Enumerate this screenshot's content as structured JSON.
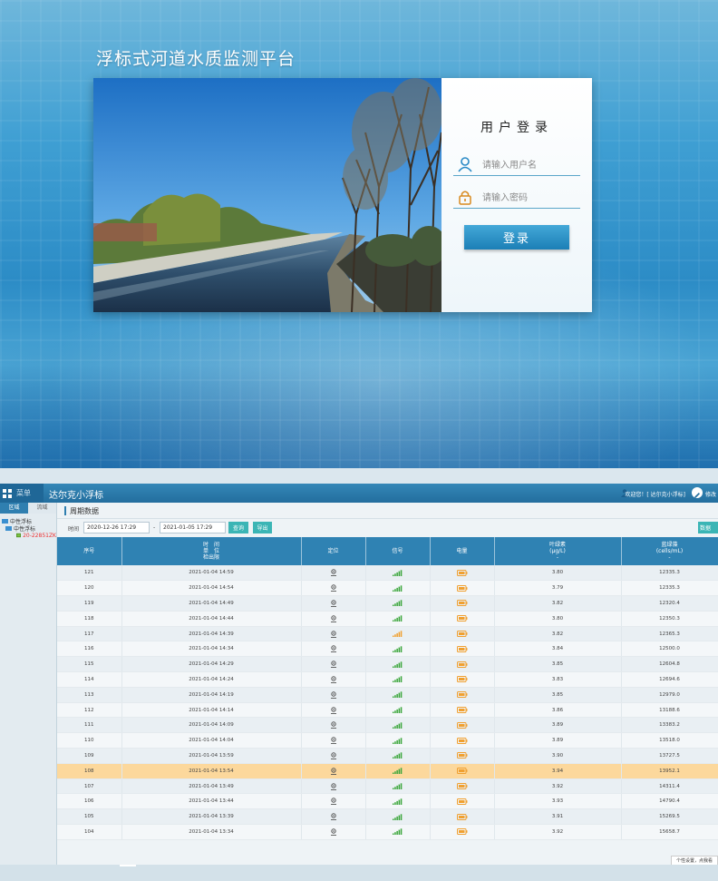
{
  "login": {
    "platform_title": "浮标式河道水质监测平台",
    "form_title": "用户登录",
    "username_placeholder": "请输入用户名",
    "password_placeholder": "请输入密码",
    "login_button": "登录"
  },
  "app": {
    "menu_label": "菜单",
    "title": "达尔克小浮标",
    "welcome": "欢迎您！[ 达尔克小浮标]",
    "edit_label": "修改",
    "sidebar": {
      "tabs": [
        "区域",
        "流域"
      ],
      "tree": [
        {
          "label": "中性浮标",
          "level": 1
        },
        {
          "label": "中性浮标",
          "level": 2
        },
        {
          "label": "20-22851ZK",
          "level": 3
        }
      ]
    },
    "section_title": "周期数据",
    "filter": {
      "time_label": "时间",
      "start": "2020-12-26 17:29",
      "end": "2021-01-05 17:29",
      "dash": "-",
      "query_button": "查询",
      "export_button": "导出",
      "data_button": "数据"
    },
    "table": {
      "headers": {
        "seq": "序号",
        "time": [
          "时　间",
          "单　位",
          "检出限"
        ],
        "location": "定位",
        "signal": "信号",
        "battery": "电量",
        "chl": [
          "叶绿素",
          "(μg/L)",
          "-"
        ],
        "algae": [
          "蓝绿藻",
          "(cells/mL)",
          "-"
        ]
      },
      "rows": [
        {
          "seq": "121",
          "time": "2021-01-04 14:59",
          "chl": "3.80",
          "algae": "12335.3",
          "signal": "green"
        },
        {
          "seq": "120",
          "time": "2021-01-04 14:54",
          "chl": "3.79",
          "algae": "12335.3",
          "signal": "green"
        },
        {
          "seq": "119",
          "time": "2021-01-04 14:49",
          "chl": "3.82",
          "algae": "12320.4",
          "signal": "green"
        },
        {
          "seq": "118",
          "time": "2021-01-04 14:44",
          "chl": "3.80",
          "algae": "12350.3",
          "signal": "green"
        },
        {
          "seq": "117",
          "time": "2021-01-04 14:39",
          "chl": "3.82",
          "algae": "12365.3",
          "signal": "orange"
        },
        {
          "seq": "116",
          "time": "2021-01-04 14:34",
          "chl": "3.84",
          "algae": "12500.0",
          "signal": "green"
        },
        {
          "seq": "115",
          "time": "2021-01-04 14:29",
          "chl": "3.85",
          "algae": "12604.8",
          "signal": "green"
        },
        {
          "seq": "114",
          "time": "2021-01-04 14:24",
          "chl": "3.83",
          "algae": "12694.6",
          "signal": "green"
        },
        {
          "seq": "113",
          "time": "2021-01-04 14:19",
          "chl": "3.85",
          "algae": "12979.0",
          "signal": "green"
        },
        {
          "seq": "112",
          "time": "2021-01-04 14:14",
          "chl": "3.86",
          "algae": "13188.6",
          "signal": "green"
        },
        {
          "seq": "111",
          "time": "2021-01-04 14:09",
          "chl": "3.89",
          "algae": "13383.2",
          "signal": "green"
        },
        {
          "seq": "110",
          "time": "2021-01-04 14:04",
          "chl": "3.89",
          "algae": "13518.0",
          "signal": "green"
        },
        {
          "seq": "109",
          "time": "2021-01-04 13:59",
          "chl": "3.90",
          "algae": "13727.5",
          "signal": "green"
        },
        {
          "seq": "108",
          "time": "2021-01-04 13:54",
          "chl": "3.94",
          "algae": "13952.1",
          "signal": "green",
          "highlight": true
        },
        {
          "seq": "107",
          "time": "2021-01-04 13:49",
          "chl": "3.92",
          "algae": "14311.4",
          "signal": "green"
        },
        {
          "seq": "106",
          "time": "2021-01-04 13:44",
          "chl": "3.93",
          "algae": "14790.4",
          "signal": "green"
        },
        {
          "seq": "105",
          "time": "2021-01-04 13:39",
          "chl": "3.91",
          "algae": "15269.5",
          "signal": "green"
        },
        {
          "seq": "104",
          "time": "2021-01-04 13:34",
          "chl": "3.92",
          "algae": "15658.7",
          "signal": "green"
        }
      ]
    },
    "personal_settings": "个性设置，点我看"
  },
  "colors": {
    "header_blue": "#2f82b3",
    "button_teal": "#3bb5b5",
    "highlight_row": "#fcd89c",
    "signal_green": "#3aa63a",
    "signal_orange": "#f0a030",
    "battery_orange": "#f0a030"
  }
}
